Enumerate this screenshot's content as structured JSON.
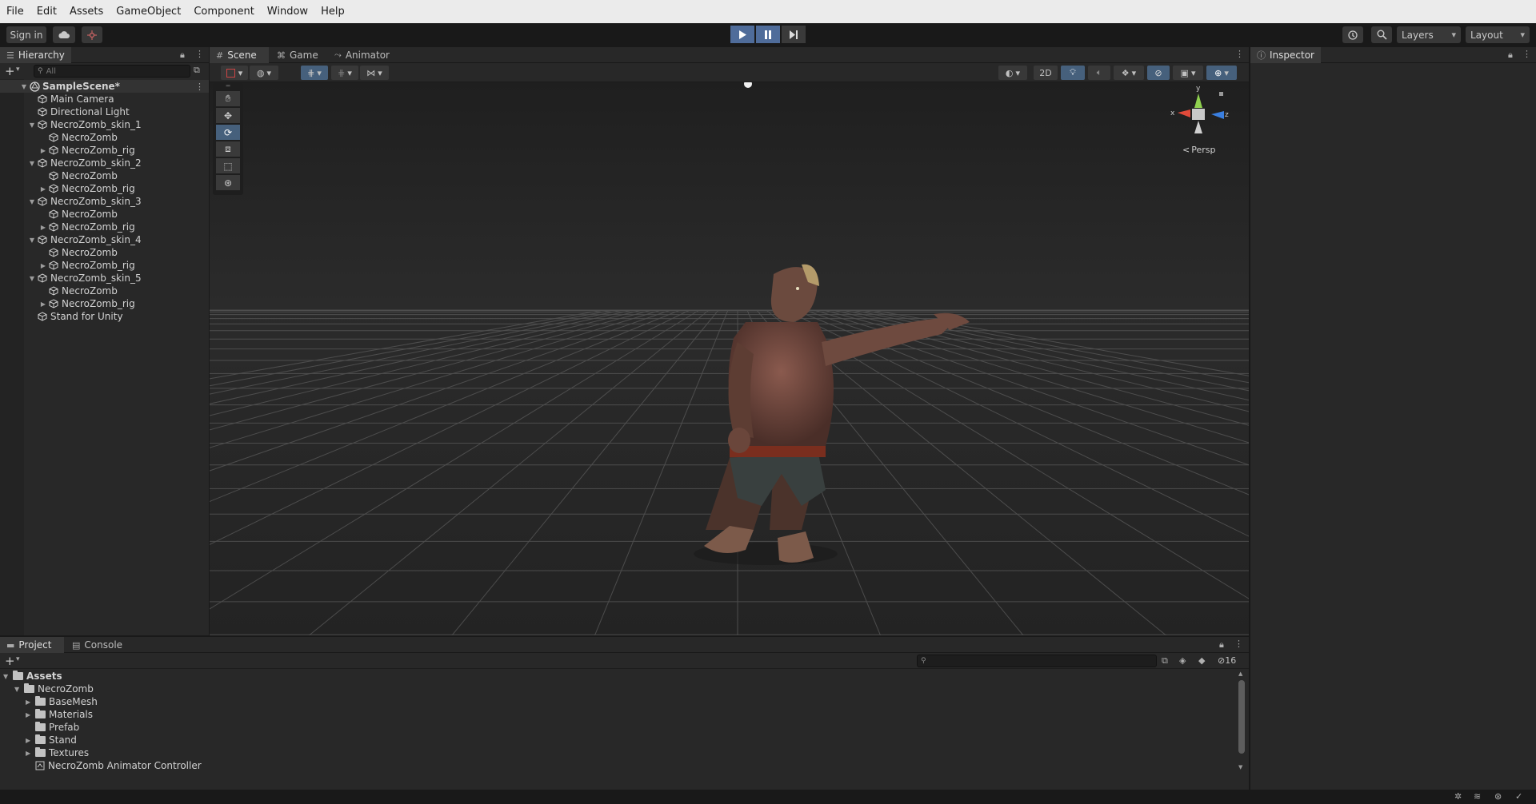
{
  "menu": [
    "File",
    "Edit",
    "Assets",
    "GameObject",
    "Component",
    "Window",
    "Help"
  ],
  "toolbar": {
    "sign_in": "Sign in",
    "layers": "Layers",
    "layout": "Layout"
  },
  "hierarchy": {
    "tab": "Hierarchy",
    "search_placeholder": "All",
    "scene": "SampleScene*",
    "items": [
      {
        "label": "Main Camera",
        "depth": 1,
        "arrow": ""
      },
      {
        "label": "Directional Light",
        "depth": 1,
        "arrow": ""
      },
      {
        "label": "NecroZomb_skin_1",
        "depth": 1,
        "arrow": "down"
      },
      {
        "label": "NecroZomb",
        "depth": 2,
        "arrow": ""
      },
      {
        "label": "NecroZomb_rig",
        "depth": 2,
        "arrow": "right"
      },
      {
        "label": "NecroZomb_skin_2",
        "depth": 1,
        "arrow": "down"
      },
      {
        "label": "NecroZomb",
        "depth": 2,
        "arrow": ""
      },
      {
        "label": "NecroZomb_rig",
        "depth": 2,
        "arrow": "right"
      },
      {
        "label": "NecroZomb_skin_3",
        "depth": 1,
        "arrow": "down"
      },
      {
        "label": "NecroZomb",
        "depth": 2,
        "arrow": ""
      },
      {
        "label": "NecroZomb_rig",
        "depth": 2,
        "arrow": "right"
      },
      {
        "label": "NecroZomb_skin_4",
        "depth": 1,
        "arrow": "down"
      },
      {
        "label": "NecroZomb",
        "depth": 2,
        "arrow": ""
      },
      {
        "label": "NecroZomb_rig",
        "depth": 2,
        "arrow": "right"
      },
      {
        "label": "NecroZomb_skin_5",
        "depth": 1,
        "arrow": "down"
      },
      {
        "label": "NecroZomb",
        "depth": 2,
        "arrow": ""
      },
      {
        "label": "NecroZomb_rig",
        "depth": 2,
        "arrow": "right"
      },
      {
        "label": "Stand for Unity",
        "depth": 1,
        "arrow": ""
      }
    ]
  },
  "scene_tabs": {
    "scene": "Scene",
    "game": "Game",
    "animator": "Animator"
  },
  "scene_toolbar": {
    "mode_2d": "2D",
    "persp": "Persp",
    "axis_x": "x",
    "axis_y": "y",
    "axis_z": "z"
  },
  "inspector": {
    "tab": "Inspector"
  },
  "project": {
    "tab_project": "Project",
    "tab_console": "Console",
    "hidden_count": "16",
    "tree": [
      {
        "label": "Assets",
        "depth": 0,
        "arrow": "down",
        "kind": "folder-open",
        "bold": true
      },
      {
        "label": "NecroZomb",
        "depth": 1,
        "arrow": "down",
        "kind": "folder-open"
      },
      {
        "label": "BaseMesh",
        "depth": 2,
        "arrow": "right",
        "kind": "folder"
      },
      {
        "label": "Materials",
        "depth": 2,
        "arrow": "right",
        "kind": "folder"
      },
      {
        "label": "Prefab",
        "depth": 2,
        "arrow": "",
        "kind": "folder"
      },
      {
        "label": "Stand",
        "depth": 2,
        "arrow": "right",
        "kind": "folder"
      },
      {
        "label": "Textures",
        "depth": 2,
        "arrow": "right",
        "kind": "folder"
      },
      {
        "label": "NecroZomb Animator Controller",
        "depth": 2,
        "arrow": "",
        "kind": "animator"
      }
    ]
  },
  "colors": {
    "accent": "#4f6c9a",
    "panel": "#282828",
    "background": "#191919",
    "menubar": "#ebebeb"
  }
}
